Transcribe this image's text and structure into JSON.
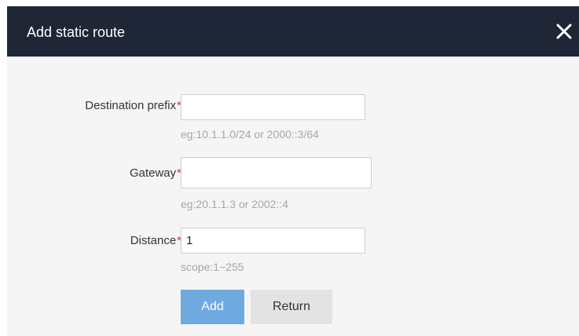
{
  "dialog": {
    "title": "Add static route",
    "close_icon": "close-icon"
  },
  "form": {
    "required_marker": "*",
    "destination_prefix": {
      "label": "Destination prefix",
      "value": "",
      "hint": "eg:10.1.1.0/24 or 2000::3/64"
    },
    "gateway": {
      "label": "Gateway",
      "value": "",
      "hint": "eg:20.1.1.3 or 2002::4"
    },
    "distance": {
      "label": "Distance",
      "value": "1",
      "hint": "scope:1−255"
    }
  },
  "buttons": {
    "add_label": "Add",
    "return_label": "Return"
  },
  "colors": {
    "header_bg": "#1f2636",
    "required": "#e0302e",
    "primary_button": "#6ea9e0",
    "secondary_button": "#e3e3e3"
  }
}
